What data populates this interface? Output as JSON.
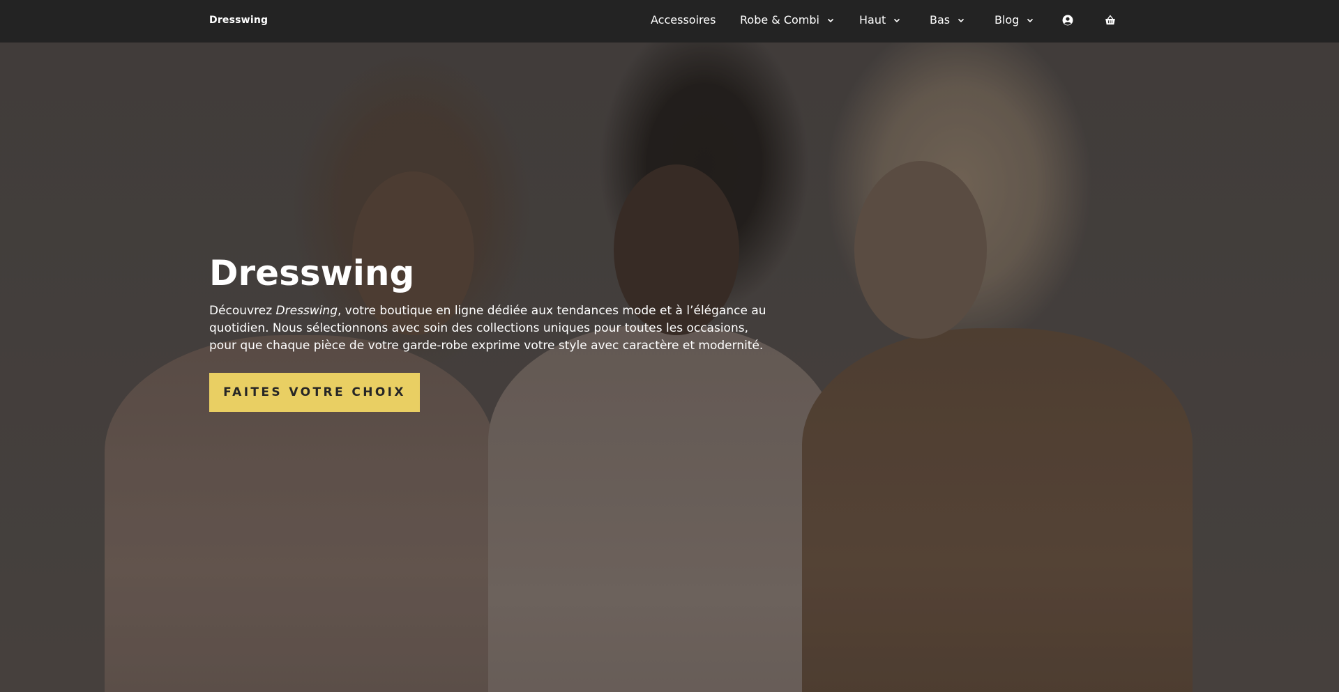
{
  "header": {
    "brand": "Dresswing",
    "nav": [
      {
        "label": "Accessoires",
        "has_dropdown": false
      },
      {
        "label": "Robe & Combi",
        "has_dropdown": true
      },
      {
        "label": "Haut",
        "has_dropdown": true
      },
      {
        "label": "Bas",
        "has_dropdown": true
      },
      {
        "label": "Blog",
        "has_dropdown": true
      }
    ],
    "icons": [
      "user-icon",
      "shopping-bag-icon"
    ]
  },
  "hero": {
    "title": "Dresswing",
    "text_before": "Découvrez ",
    "text_emphasis": "Dresswing",
    "text_after": ", votre boutique en ligne dédiée aux tendances mode et à l’élégance au quotidien. Nous sélectionnons avec soin des collections uniques pour toutes les occasions, pour que chaque pièce de votre garde-robe exprime votre style avec caractère et modernité.",
    "cta_label": "FAITES VOTRE CHOIX"
  },
  "colors": {
    "header_bg": "#232323",
    "cta_bg": "#e9cf63",
    "cta_text": "#262626",
    "text": "#ffffff"
  }
}
